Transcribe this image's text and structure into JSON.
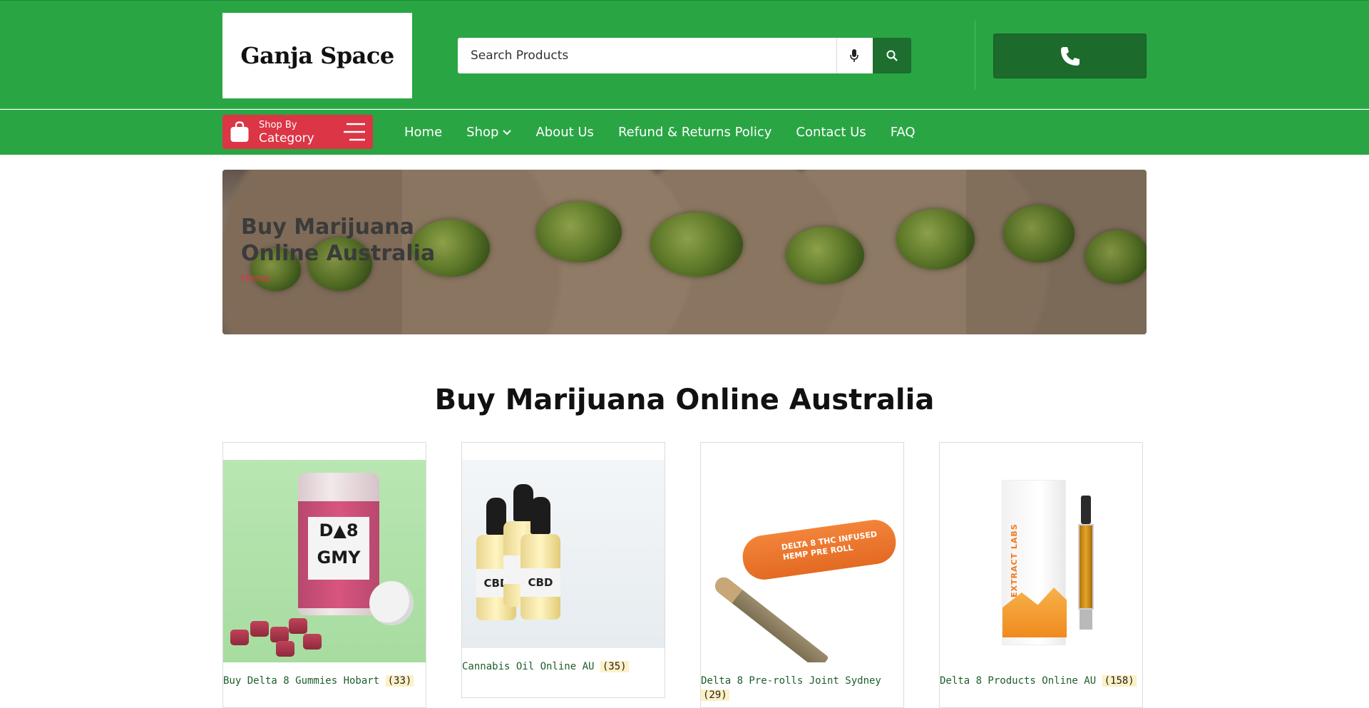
{
  "header": {
    "logo_text": "Ganja Space",
    "search_placeholder": "Search Products"
  },
  "icons": {
    "mic": "microphone-icon",
    "search": "search-icon",
    "phone": "phone-icon",
    "bag": "shopping-bag-icon",
    "menu": "hamburger-menu-icon",
    "chevron": "chevron-down-icon"
  },
  "nav": {
    "category_small": "Shop By",
    "category_big": "Category",
    "links": [
      {
        "label": "Home"
      },
      {
        "label": "Shop"
      },
      {
        "label": "About Us"
      },
      {
        "label": "Refund & Returns Policy"
      },
      {
        "label": "Contact Us"
      },
      {
        "label": "FAQ"
      }
    ]
  },
  "banner": {
    "title": "Buy Marijuana Online Australia",
    "breadcrumb": "Home"
  },
  "main": {
    "heading": "Buy Marijuana Online Australia",
    "products": [
      {
        "name": "Buy Delta 8 Gummies Hobart",
        "count": "(33)"
      },
      {
        "name": "Cannabis Oil Online AU",
        "count": "(35)"
      },
      {
        "name": "Delta 8 Pre-rolls Joint Sydney",
        "count": "(29)"
      },
      {
        "name": "Delta 8 Products Online AU",
        "count": "(158)"
      }
    ]
  },
  "colors": {
    "header_green": "#2aa544",
    "dark_green": "#1c6b2c",
    "category_red": "#dc3545",
    "count_highlight": "#fcf0c4"
  }
}
